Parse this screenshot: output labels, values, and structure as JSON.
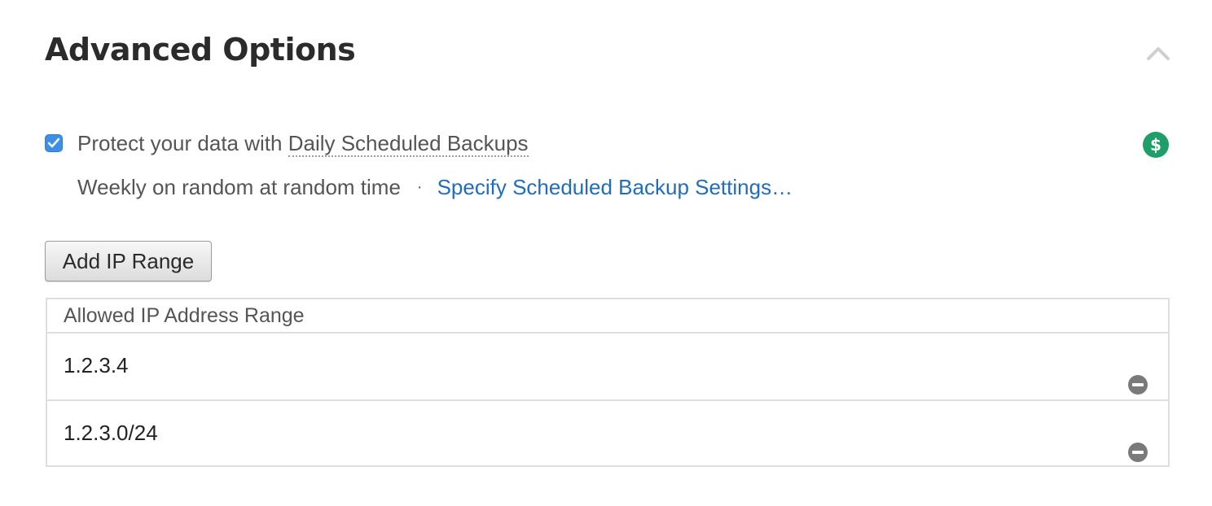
{
  "section": {
    "title": "Advanced Options",
    "collapse_icon": "chevron-up-icon"
  },
  "backup": {
    "checked": true,
    "label_prefix": "Protect your data with",
    "label_link": "Daily Scheduled Backups",
    "cost_icon": "dollar-icon",
    "cost_color": "#1f9e6a",
    "schedule_text": "Weekly on random at random time",
    "separator": "·",
    "settings_link": "Specify Scheduled Backup Settings…"
  },
  "ip": {
    "add_button": "Add IP Range",
    "column_header": "Allowed IP Address Range",
    "rows": [
      {
        "value": "1.2.3.4",
        "remove_icon": "remove-icon"
      },
      {
        "value": "1.2.3.0/24",
        "remove_icon": "remove-icon"
      }
    ]
  },
  "colors": {
    "accent": "#3d8ee8",
    "link": "#1f6dc0",
    "border": "#dedede"
  }
}
